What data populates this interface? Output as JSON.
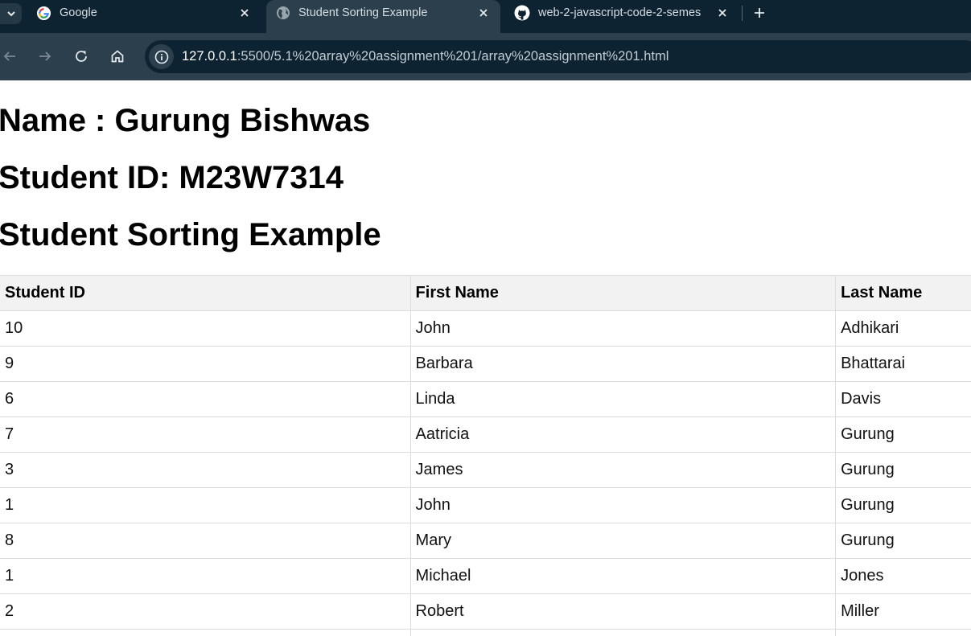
{
  "browser": {
    "tabs": [
      {
        "title": "Google",
        "icon": "google-icon",
        "active": false
      },
      {
        "title": "Student Sorting Example",
        "icon": "globe-icon",
        "active": true
      },
      {
        "title": "web-2-javascript-code-2-semes",
        "icon": "github-icon",
        "active": false
      }
    ],
    "url": {
      "host": "127.0.0.1",
      "rest": ":5500/5.1%20array%20assignment%201/array%20assignment%201.html"
    }
  },
  "page": {
    "name_heading": "Name : Gurung Bishwas",
    "id_heading": "Student ID: M23W7314",
    "title_heading": "Student Sorting Example"
  },
  "table": {
    "headers": [
      "Student ID",
      "First Name",
      "Last Name"
    ],
    "rows": [
      [
        "10",
        "John",
        "Adhikari"
      ],
      [
        "9",
        "Barbara",
        "Bhattarai"
      ],
      [
        "6",
        "Linda",
        "Davis"
      ],
      [
        "7",
        "Aatricia",
        "Gurung"
      ],
      [
        "3",
        "James",
        "Gurung"
      ],
      [
        "1",
        "John",
        "Gurung"
      ],
      [
        "8",
        "Mary",
        "Gurung"
      ],
      [
        "1",
        "Michael",
        "Jones"
      ],
      [
        "2",
        "Robert",
        "Miller"
      ]
    ]
  },
  "colors": {
    "tabstrip": "#0e2331",
    "toolbar": "#2b3f4d",
    "header_bg": "#f2f2f2",
    "border": "#dddddd"
  }
}
